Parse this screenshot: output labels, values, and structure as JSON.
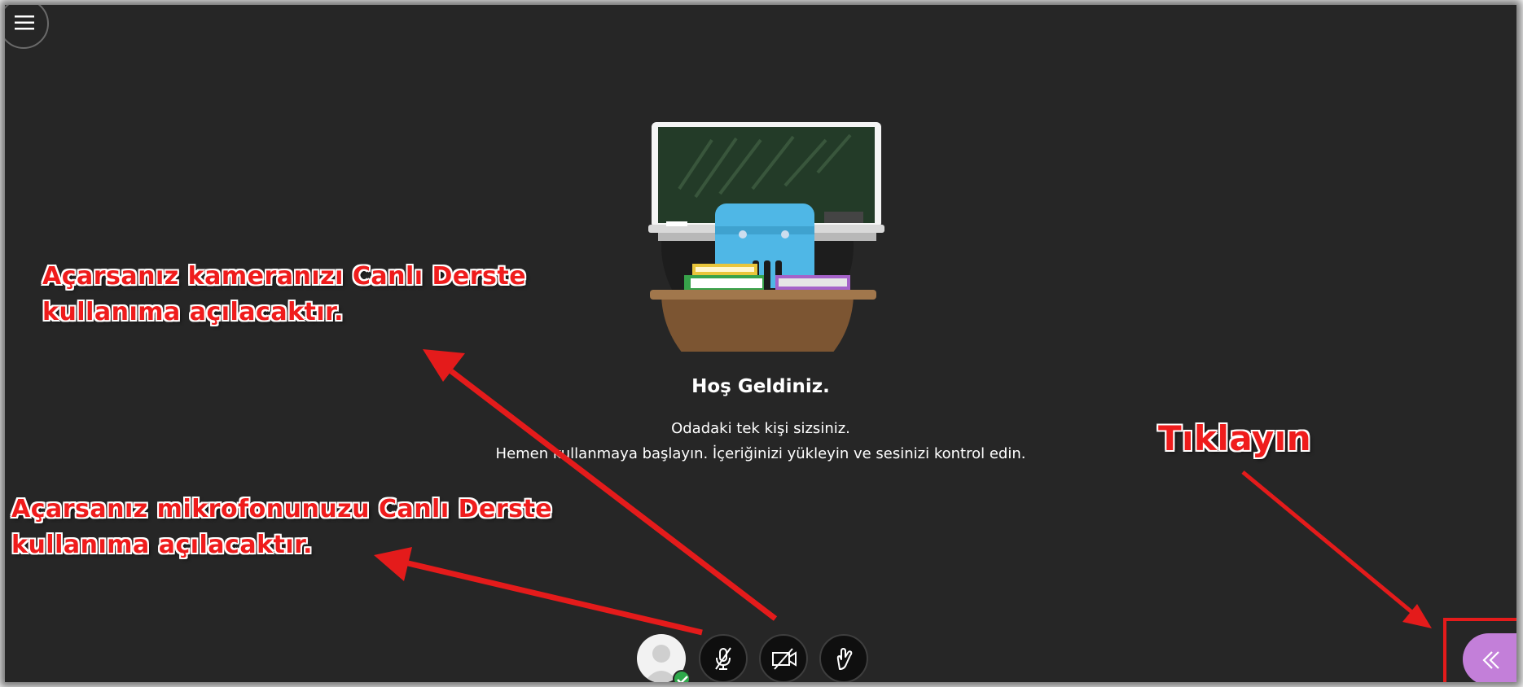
{
  "welcome": {
    "title": "Hoş Geldiniz.",
    "line1": "Odadaki tek kişi sizsiniz.",
    "line2": "Hemen kullanmaya başlayın. İçeriğinizi yükleyin ve sesinizi kontrol edin."
  },
  "annotations": {
    "camera_line1": "Açarsanız kameranızı Canlı Derste",
    "camera_line2": "kullanıma açılacaktır.",
    "mic_line1": "Açarsanız mikrofonunuzu Canlı Derste",
    "mic_line2": "kullanıma açılacaktır.",
    "click": "Tıklayın"
  },
  "icons": {
    "menu": "hamburger-menu-icon",
    "avatar": "user-avatar-icon",
    "status": "checkmark-icon",
    "microphone": "microphone-off-icon",
    "camera": "camera-off-icon",
    "hand": "raise-hand-icon",
    "collab_panel": "double-chevron-left-icon"
  },
  "colors": {
    "background": "#262626",
    "annotation_red": "#ef1c1c",
    "collab_purple": "#c37fd9",
    "status_green": "#2ea84a"
  }
}
